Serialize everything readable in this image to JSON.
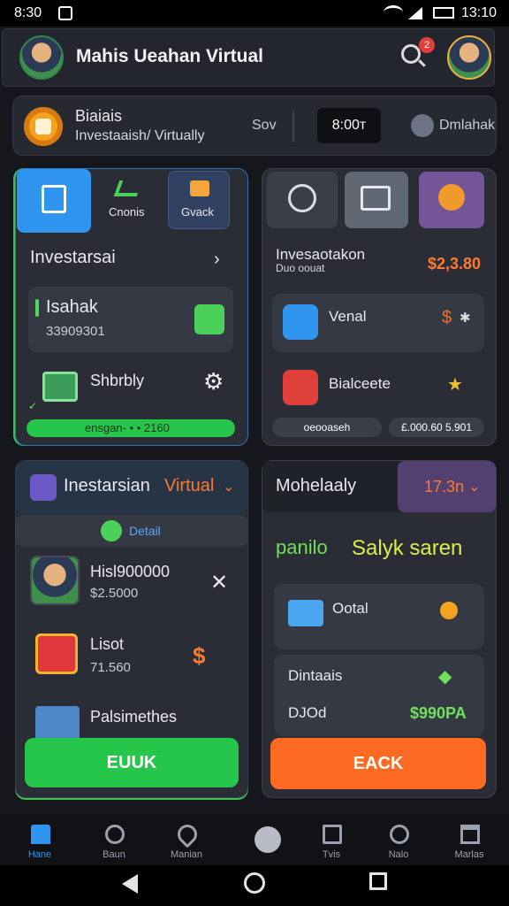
{
  "status": {
    "time": "8:30",
    "clock": "13:10"
  },
  "header": {
    "title": "Mahis Ueahan Virtual",
    "notification_count": "2"
  },
  "infobar": {
    "name": "Biaiais",
    "subtitle": "Investaaish/ Virtually",
    "label": "Sov",
    "value": "8:00т",
    "right_label": "Dmlahak"
  },
  "panel_left_top": {
    "tabs": [
      {
        "label": "Cnonis"
      },
      {
        "label": "Gvack"
      }
    ],
    "heading": "Investarsai",
    "row1_label": "Isahak",
    "row1_value": "33909301",
    "row2_label": "Shbrbly",
    "progress_text": "ensgan- • • 2160"
  },
  "panel_right_top": {
    "heading": "Invesaotakon",
    "subheading": "Duo oouat",
    "amount": "$2,3.80",
    "row1_label": "Venal",
    "row2_label": "Bialceete",
    "chip1": "oeooaseh",
    "chip2": "£.000.60 5.901"
  },
  "panel_left_bottom": {
    "heading_a": "Inestarsian",
    "heading_b": "Virtual",
    "detail": "Detail",
    "item1_name": "Hisl900000",
    "item1_value": "$2.5000",
    "item2_name": "Lisot",
    "item2_value": "71.560",
    "item3_name": "Palsimethes",
    "button": "EUUK"
  },
  "panel_right_bottom": {
    "heading": "Mohelaaly",
    "value": "17.3n",
    "slogan_a": "panilo",
    "slogan_b": "Salyk saren",
    "row1_label": "Ootal",
    "row2_label": "Dintaais",
    "row3_label": "DJOd",
    "row3_value": "$990PA",
    "button": "EACK"
  },
  "nav": {
    "items": [
      {
        "label": "Hane",
        "icon": "home-icon"
      },
      {
        "label": "Baun",
        "icon": "search-icon"
      },
      {
        "label": "Manian",
        "icon": "heart-icon"
      },
      {
        "label": "",
        "icon": "chat-icon"
      },
      {
        "label": "Tvis",
        "icon": "tv-icon"
      },
      {
        "label": "Nalo",
        "icon": "face-icon"
      },
      {
        "label": "Marlas",
        "icon": "crown-icon"
      }
    ]
  },
  "colors": {
    "accent_blue": "#2f95ef",
    "accent_green": "#26c64a",
    "accent_orange": "#ff6a22",
    "panel": "#2a2d36"
  }
}
